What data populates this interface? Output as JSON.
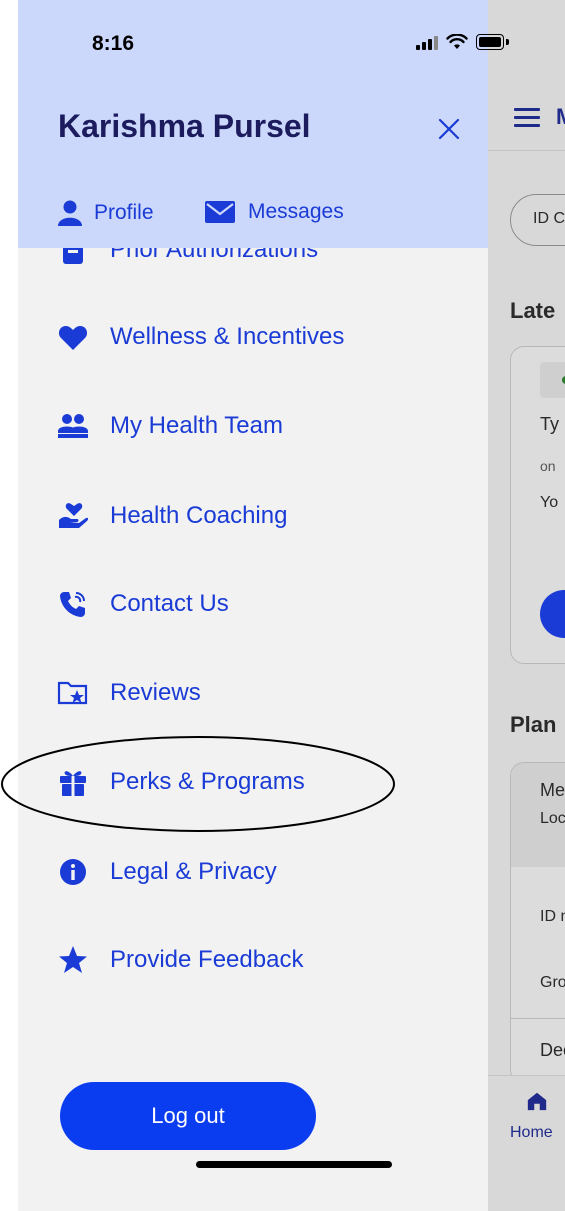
{
  "status_bar": {
    "time": "8:16"
  },
  "drawer": {
    "user_name": "Karishma Pursel",
    "header_links": {
      "profile": "Profile",
      "messages": "Messages"
    },
    "menu_items": [
      {
        "label": "Prior Authorizations",
        "icon": "clipboard-icon"
      },
      {
        "label": "Wellness & Incentives",
        "icon": "heart-icon"
      },
      {
        "label": "My Health Team",
        "icon": "group-icon"
      },
      {
        "label": "Health Coaching",
        "icon": "hand-heart-icon"
      },
      {
        "label": "Contact Us",
        "icon": "phone-icon"
      },
      {
        "label": "Reviews",
        "icon": "folder-star-icon"
      },
      {
        "label": "Perks & Programs",
        "icon": "gift-icon"
      },
      {
        "label": "Legal & Privacy",
        "icon": "info-icon"
      },
      {
        "label": "Provide Feedback",
        "icon": "star-icon"
      }
    ],
    "logout_label": "Log out"
  },
  "background_app": {
    "title": "M",
    "chip": "ID C",
    "heading_latest": "Late",
    "card_title": "Ty",
    "card_sub": "on",
    "card_body": "Yo",
    "heading_plan": "Plan",
    "plan_row1_title": "Me",
    "plan_row1_sub": "Loc",
    "plan_row2": "ID n",
    "plan_row3": "Gro",
    "plan_row4": "Dec",
    "nav_home": "Home"
  },
  "colors": {
    "accent": "#1a3bd6",
    "header_bg": "#ccd8fb",
    "logout_bg": "#0a3cf0"
  }
}
